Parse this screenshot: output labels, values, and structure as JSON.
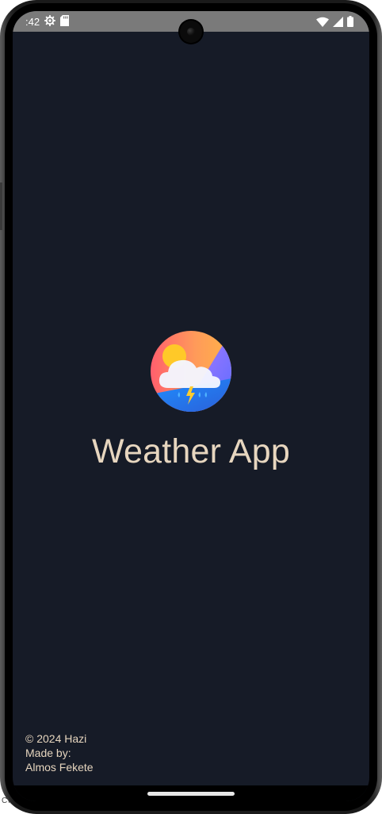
{
  "status_bar": {
    "time": ":42",
    "icons": [
      "settings-gear-icon",
      "sd-card-icon",
      "wifi-icon",
      "cellular-signal-icon",
      "battery-icon"
    ]
  },
  "splash": {
    "title": "Weather App",
    "logo_icon": "weather-storm-logo-icon"
  },
  "footer": {
    "line1": "© 2024 Hazi",
    "line2": "Made by:",
    "line3": "Almos Fekete"
  },
  "corner_text": "C\\",
  "colors": {
    "screen_background": "#161b27",
    "title_text": "#e7d6bf",
    "status_bar": "#7a7a7a",
    "logo_gradient_start": "#ff7a6e",
    "logo_gradient_mid": "#ffb347",
    "logo_gradient_end": "#6b7bff"
  }
}
